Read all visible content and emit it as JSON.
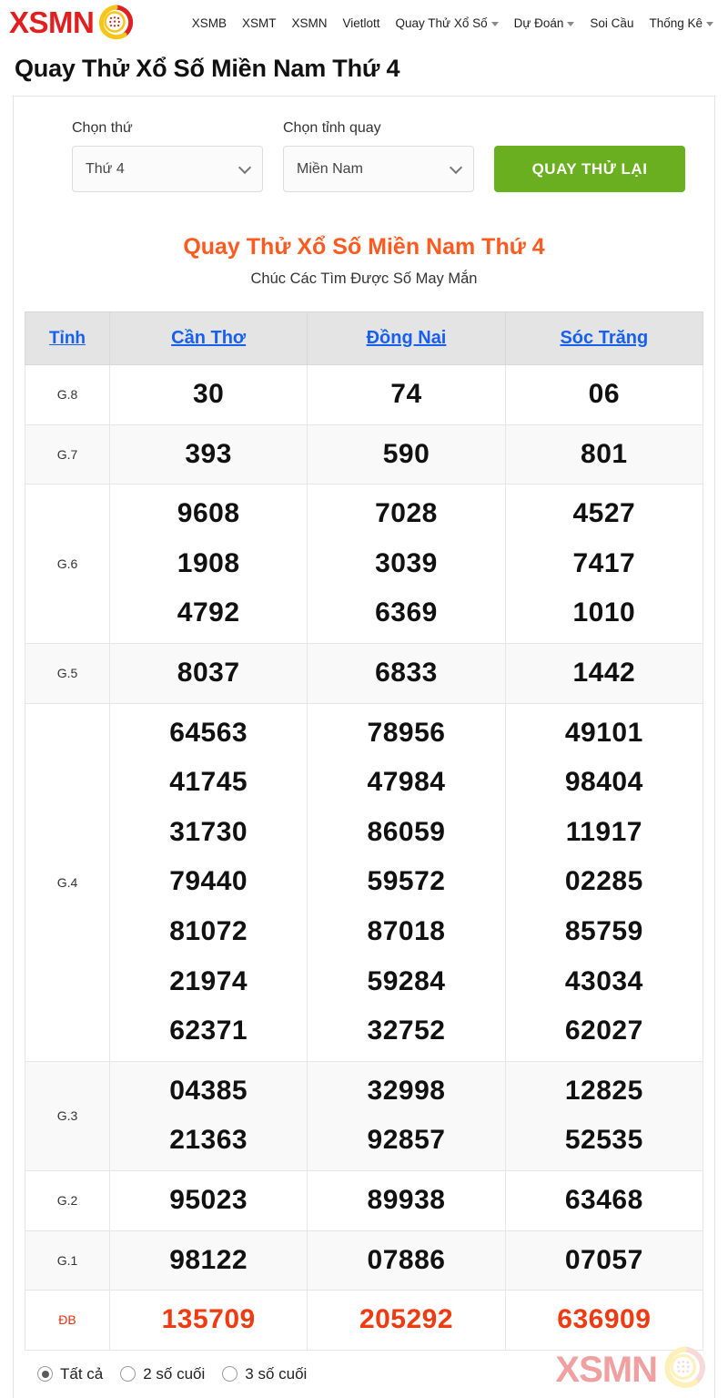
{
  "header": {
    "brand": {
      "text": "XSMN",
      "icon": "lottery-ball-icon",
      "color": "#e02020"
    },
    "nav": [
      {
        "label": "XSMB",
        "dropdown": false
      },
      {
        "label": "XSMT",
        "dropdown": false
      },
      {
        "label": "XSMN",
        "dropdown": false
      },
      {
        "label": "Vietlott",
        "dropdown": false
      },
      {
        "label": "Quay Thử Xổ Số",
        "dropdown": true
      },
      {
        "label": "Dự Đoán",
        "dropdown": true
      },
      {
        "label": "Soi Cầu",
        "dropdown": false
      },
      {
        "label": "Thống Kê",
        "dropdown": true
      }
    ]
  },
  "page": {
    "title": "Quay Thử Xổ Số Miền Nam Thứ 4"
  },
  "controls": {
    "day": {
      "label": "Chọn thứ",
      "value": "Thứ 4"
    },
    "province": {
      "label": "Chọn tỉnh quay",
      "value": "Miền Nam"
    },
    "spin_button": "QUAY THỬ LẠI"
  },
  "result": {
    "heading": "Quay Thử Xổ Số Miền Nam Thứ 4",
    "subheading": "Chúc Các Tìm Được Số May Mắn",
    "heading_color": "#ff5a1f"
  },
  "table": {
    "headers": [
      "Tỉnh",
      "Cần Thơ",
      "Đồng Nai",
      "Sóc Trăng"
    ],
    "rows": [
      {
        "prize": "G.8",
        "cells": [
          [
            "30"
          ],
          [
            "74"
          ],
          [
            "06"
          ]
        ]
      },
      {
        "prize": "G.7",
        "cells": [
          [
            "393"
          ],
          [
            "590"
          ],
          [
            "801"
          ]
        ]
      },
      {
        "prize": "G.6",
        "cells": [
          [
            "9608",
            "1908",
            "4792"
          ],
          [
            "7028",
            "3039",
            "6369"
          ],
          [
            "4527",
            "7417",
            "1010"
          ]
        ]
      },
      {
        "prize": "G.5",
        "cells": [
          [
            "8037"
          ],
          [
            "6833"
          ],
          [
            "1442"
          ]
        ]
      },
      {
        "prize": "G.4",
        "cells": [
          [
            "64563",
            "41745",
            "31730",
            "79440",
            "81072",
            "21974",
            "62371"
          ],
          [
            "78956",
            "47984",
            "86059",
            "59572",
            "87018",
            "59284",
            "32752"
          ],
          [
            "49101",
            "98404",
            "11917",
            "02285",
            "85759",
            "43034",
            "62027"
          ]
        ]
      },
      {
        "prize": "G.3",
        "cells": [
          [
            "04385",
            "21363"
          ],
          [
            "32998",
            "92857"
          ],
          [
            "12825",
            "52535"
          ]
        ]
      },
      {
        "prize": "G.2",
        "cells": [
          [
            "95023"
          ],
          [
            "89938"
          ],
          [
            "63468"
          ]
        ]
      },
      {
        "prize": "G.1",
        "cells": [
          [
            "98122"
          ],
          [
            "07886"
          ],
          [
            "07057"
          ]
        ]
      },
      {
        "prize": "ĐB",
        "special": true,
        "cells": [
          [
            "135709"
          ],
          [
            "205292"
          ],
          [
            "636909"
          ]
        ]
      }
    ],
    "special_color": "#ee3b11",
    "header_link_color": "#1560f0"
  },
  "filters": {
    "options": [
      {
        "label": "Tất cả",
        "selected": true
      },
      {
        "label": "2 số cuối",
        "selected": false
      },
      {
        "label": "3 số cuối",
        "selected": false
      }
    ]
  },
  "watermark": {
    "text": "XSMN",
    "icon": "lottery-ball-icon"
  }
}
